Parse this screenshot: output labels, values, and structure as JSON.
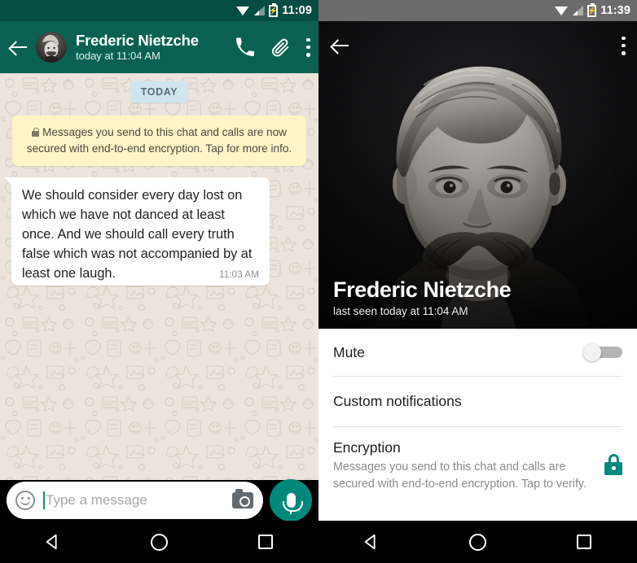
{
  "chat_screen": {
    "statusbar": {
      "time": "11:09",
      "wifi_icon": "wifi-icon",
      "signal_icon": "signal-icon",
      "battery_icon": "battery-charging-icon"
    },
    "header": {
      "back_icon": "back-arrow-icon",
      "avatar": "contact-avatar",
      "name": "Frederic Nietzche",
      "subtitle": "today at 11:04 AM",
      "call_icon": "phone-icon",
      "attach_icon": "paperclip-icon",
      "overflow_icon": "overflow-menu-icon"
    },
    "date_divider": "TODAY",
    "encryption_notice": {
      "lock_icon": "lock-icon",
      "text": "Messages you send to this chat and calls are now secured with end-to-end encryption. Tap for more info."
    },
    "messages": [
      {
        "text": "We should consider every day lost on which we have not danced at least once. And we should call every truth false which was not accompanied by at least one laugh.",
        "time": "11:03 AM"
      }
    ],
    "composer": {
      "emoji_icon": "emoji-smiley-icon",
      "placeholder": "Type a message",
      "value": "",
      "camera_icon": "camera-icon",
      "mic_icon": "microphone-icon"
    }
  },
  "contact_screen": {
    "statusbar": {
      "time": "11:39",
      "wifi_icon": "wifi-icon",
      "signal_icon": "signal-icon",
      "battery_icon": "battery-charging-icon"
    },
    "photo_header": {
      "back_icon": "back-arrow-icon",
      "overflow_icon": "overflow-menu-icon",
      "name": "Frederic Nietzche",
      "last_seen": "last seen today at 11:04 AM"
    },
    "rows": {
      "mute": {
        "label": "Mute",
        "toggle_state": "off"
      },
      "custom_notifications": {
        "label": "Custom notifications"
      },
      "encryption": {
        "label": "Encryption",
        "description": "Messages you send to this chat and calls are secured with end-to-end encryption. Tap to verify.",
        "lock_icon": "lock-icon"
      }
    }
  },
  "navbar": {
    "back_icon": "nav-back-icon",
    "home_icon": "nav-home-icon",
    "recents_icon": "nav-recents-icon"
  },
  "colors": {
    "teal_dark": "#054d42",
    "teal_header": "#0a6152",
    "accent_green": "#00897b",
    "chat_bg": "#ece4dc",
    "notice_yellow": "#fdf4c8",
    "date_pill_blue": "#cfe6f0",
    "status_gray": "#6b6b6b"
  }
}
